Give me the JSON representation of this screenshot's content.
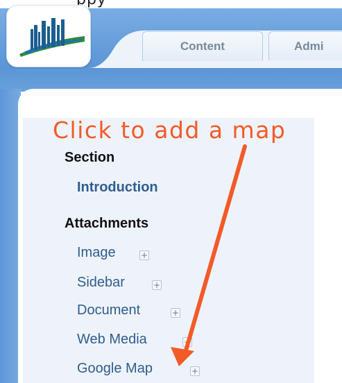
{
  "top_partial_text": "ppy",
  "tabs": {
    "content": "Content",
    "admin": "Admi"
  },
  "annotation": {
    "text": "Click to add a map",
    "color": "#f25a28"
  },
  "sidebar": {
    "section_heading": "Section",
    "section_link": "Introduction",
    "attachments_heading": "Attachments",
    "items": [
      {
        "label": "Image"
      },
      {
        "label": "Sidebar"
      },
      {
        "label": "Document"
      },
      {
        "label": "Web Media"
      },
      {
        "label": "Google Map"
      }
    ]
  },
  "colors": {
    "header_blue": "#5a95d6",
    "link_blue": "#2f5d8e",
    "arrow": "#f25a28"
  },
  "icons": {
    "logo": "city-skyline-logo",
    "add": "plus-icon"
  }
}
